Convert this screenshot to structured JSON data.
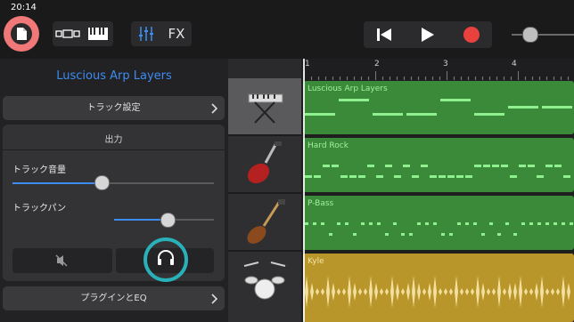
{
  "status_bar": {
    "time": "20:14"
  },
  "toolbar": {
    "fx_label": "FX",
    "colors": {
      "record": "#e8413e",
      "highlight_ring": "#f07878"
    }
  },
  "inspector": {
    "track_name": "Luscious Arp Layers",
    "track_settings_label": "トラック設定",
    "output_label": "出力",
    "track_volume_label": "トラック音量",
    "track_volume_value": 0.42,
    "track_pan_label": "トラックパン",
    "track_pan_value": 0.5,
    "plugins_eq_label": "プラグインとEQ"
  },
  "ruler": {
    "bars": [
      "1",
      "2",
      "3",
      "4"
    ]
  },
  "tracks": [
    {
      "name": "Luscious Arp Layers",
      "instrument": "keyboard-icon",
      "color": "#3a8a3a"
    },
    {
      "name": "Hard Rock",
      "instrument": "electric-guitar-icon",
      "color": "#3a8a3a"
    },
    {
      "name": "P-Bass",
      "instrument": "bass-guitar-icon",
      "color": "#3a8a3a"
    },
    {
      "name": "Kyle",
      "instrument": "drum-kit-icon",
      "color": "#b8962a"
    }
  ],
  "accent": {
    "teal_ring": "#2ab0b8",
    "blue": "#3d8cf0"
  }
}
